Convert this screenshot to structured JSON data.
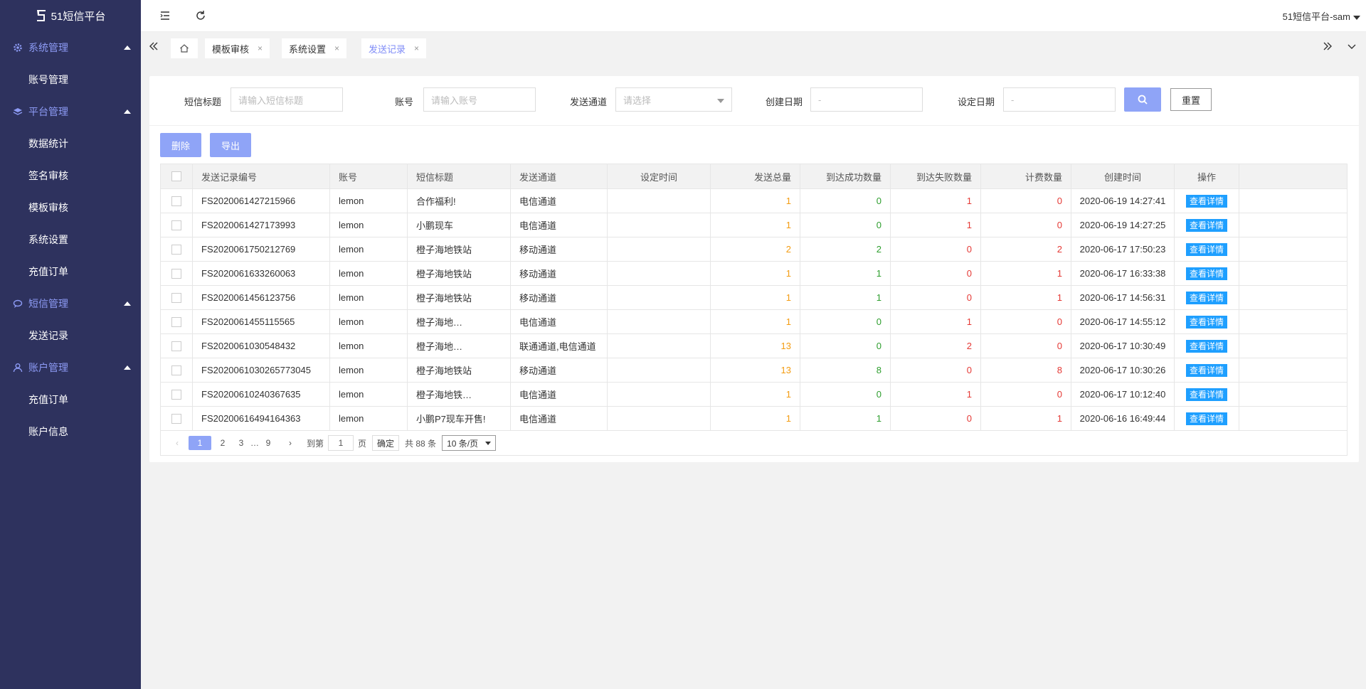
{
  "app": {
    "logo_text": "51短信平台"
  },
  "sidebar": {
    "groups": [
      {
        "label": "系统管理",
        "icon": "gear-icon",
        "items": [
          "账号管理"
        ]
      },
      {
        "label": "平台管理",
        "icon": "layers-icon",
        "items": [
          "数据统计",
          "签名审核",
          "模板审核",
          "系统设置",
          "充值订单"
        ]
      },
      {
        "label": "短信管理",
        "icon": "message-icon",
        "items": [
          "发送记录"
        ]
      },
      {
        "label": "账户管理",
        "icon": "user-icon",
        "items": [
          "充值订单",
          "账户信息"
        ]
      }
    ]
  },
  "topbar": {
    "user": "51短信平台-sam"
  },
  "tabs": [
    {
      "label": "模板审核",
      "close": "×"
    },
    {
      "label": "系统设置",
      "close": "×"
    },
    {
      "label": "发送记录",
      "close": "×"
    }
  ],
  "filters": {
    "title_label": "短信标题",
    "title_placeholder": "请输入短信标题",
    "account_label": "账号",
    "account_placeholder": "请输入账号",
    "channel_label": "发送通道",
    "channel_placeholder": "请选择",
    "created_label": "创建日期",
    "created_placeholder": "-",
    "set_label": "设定日期",
    "set_placeholder": "-",
    "reset": "重置"
  },
  "actions": {
    "delete": "删除",
    "export": "导出"
  },
  "table": {
    "headers": [
      "发送记录编号",
      "账号",
      "短信标题",
      "发送通道",
      "设定时间",
      "发送总量",
      "到达成功数量",
      "到达失败数量",
      "计费数量",
      "创建时间",
      "操作"
    ],
    "detail_label": "查看详情",
    "rows": [
      {
        "id": "FS2020061427215966",
        "account": "lemon",
        "title": "合作福利!",
        "channel": "电信通道",
        "set_time": "",
        "total": "1",
        "ok": "0",
        "fail": "1",
        "bill": "0",
        "time": "2020-06-19 14:27:41"
      },
      {
        "id": "FS2020061427173993",
        "account": "lemon",
        "title": "小鹏现车",
        "channel": "电信通道",
        "set_time": "",
        "total": "1",
        "ok": "0",
        "fail": "1",
        "bill": "0",
        "time": "2020-06-19 14:27:25"
      },
      {
        "id": "FS2020061750212769",
        "account": "lemon",
        "title": "橙子海地铁站",
        "channel": "移动通道",
        "set_time": "",
        "total": "2",
        "ok": "2",
        "fail": "0",
        "bill": "2",
        "time": "2020-06-17 17:50:23"
      },
      {
        "id": "FS2020061633260063",
        "account": "lemon",
        "title": "橙子海地铁站",
        "channel": "移动通道",
        "set_time": "",
        "total": "1",
        "ok": "1",
        "fail": "0",
        "bill": "1",
        "time": "2020-06-17 16:33:38"
      },
      {
        "id": "FS2020061456123756",
        "account": "lemon",
        "title": "橙子海地铁站",
        "channel": "移动通道",
        "set_time": "",
        "total": "1",
        "ok": "1",
        "fail": "0",
        "bill": "1",
        "time": "2020-06-17 14:56:31"
      },
      {
        "id": "FS2020061455115565",
        "account": "lemon",
        "title": "橙子海地…",
        "channel": "电信通道",
        "set_time": "",
        "total": "1",
        "ok": "0",
        "fail": "1",
        "bill": "0",
        "time": "2020-06-17 14:55:12"
      },
      {
        "id": "FS2020061030548432",
        "account": "lemon",
        "title": "橙子海地…",
        "channel": "联通通道,电信通道",
        "set_time": "",
        "total": "13",
        "ok": "0",
        "fail": "2",
        "bill": "0",
        "time": "2020-06-17 10:30:49"
      },
      {
        "id": "FS2020061030265773045",
        "account": "lemon",
        "title": "橙子海地铁站",
        "channel": "移动通道",
        "set_time": "",
        "total": "13",
        "ok": "8",
        "fail": "0",
        "bill": "8",
        "time": "2020-06-17 10:30:26"
      },
      {
        "id": "FS20200610240367635",
        "account": "lemon",
        "title": "橙子海地铁…",
        "channel": "电信通道",
        "set_time": "",
        "total": "1",
        "ok": "0",
        "fail": "1",
        "bill": "0",
        "time": "2020-06-17 10:12:40"
      },
      {
        "id": "FS20200616494164363",
        "account": "lemon",
        "title": "小鹏P7现车开售!",
        "channel": "电信通道",
        "set_time": "",
        "total": "1",
        "ok": "1",
        "fail": "0",
        "bill": "1",
        "time": "2020-06-16 16:49:44"
      }
    ]
  },
  "pagination": {
    "prev": "‹",
    "pages": [
      "1",
      "2",
      "3"
    ],
    "ellipsis": "…",
    "last": "9",
    "next": "›",
    "goto_label": "到第",
    "goto_value": "1",
    "page_unit": "页",
    "confirm": "确定",
    "total": "共 88 条",
    "page_size": "10 条/页"
  },
  "colors": {
    "sidebar_bg": "#2e325e",
    "accent": "#8fa4f7",
    "detail_btn": "#1e9fff"
  }
}
